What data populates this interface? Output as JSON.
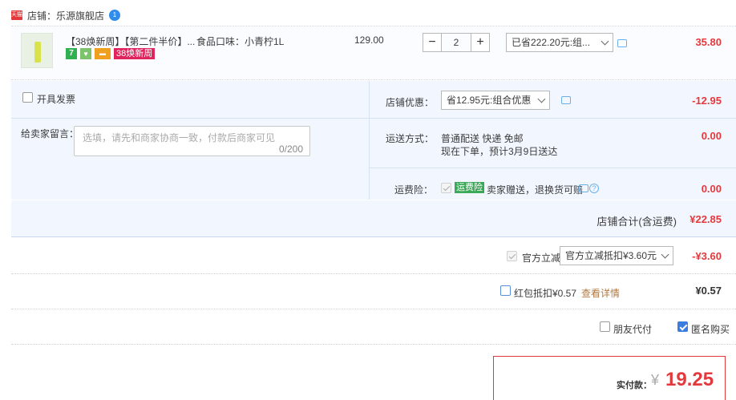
{
  "shop": {
    "badge": "天猫",
    "name": "店铺：乐源旗舰店",
    "wangwang": "1"
  },
  "item": {
    "title": "【38焕新周】【第二件半价】...",
    "badge_38": "38焕新周",
    "badge_7": "7",
    "sku": "食品口味：小青柠1L",
    "unit_price": "129.00",
    "quantity": "2",
    "minus": "−",
    "plus": "+",
    "promo": "已省222.20元:组...",
    "total": "35.80"
  },
  "invoice": {
    "label": "开具发票"
  },
  "message": {
    "label": "给卖家留言：",
    "placeholder": "选填，请先和商家协商一致，付款后商家可见",
    "count": "0/200"
  },
  "shop_discount": {
    "label": "店铺优惠：",
    "value": "省12.95元:组合优惠",
    "amount": "-12.95"
  },
  "delivery": {
    "label": "运送方式：",
    "line1": "普通配送 快递 免邮",
    "line2": "现在下单，预计3月9日送达",
    "amount": "0.00"
  },
  "insurance": {
    "label": "运费险：",
    "tag": "运费险",
    "text": "卖家赠送，退换货可赔",
    "help": "?",
    "amount": "0.00"
  },
  "subtotal": {
    "label": "店铺合计(含运费)",
    "value": "¥22.85"
  },
  "official": {
    "label": "官方立减",
    "value": "官方立减抵扣¥3.60元",
    "amount": "-¥3.60"
  },
  "redpacket": {
    "label": "红包抵扣¥0.57",
    "link": "查看详情",
    "amount": "¥0.57"
  },
  "options": {
    "friend_pay": "朋友代付",
    "anonymous": "匿名购买"
  },
  "payment": {
    "label": "实付款：",
    "currency": "¥",
    "amount": "19.25"
  },
  "colors": {
    "accent_red": "#e4393c",
    "panel_blue": "#f2f7ff",
    "check_blue": "#3b7ee0"
  }
}
